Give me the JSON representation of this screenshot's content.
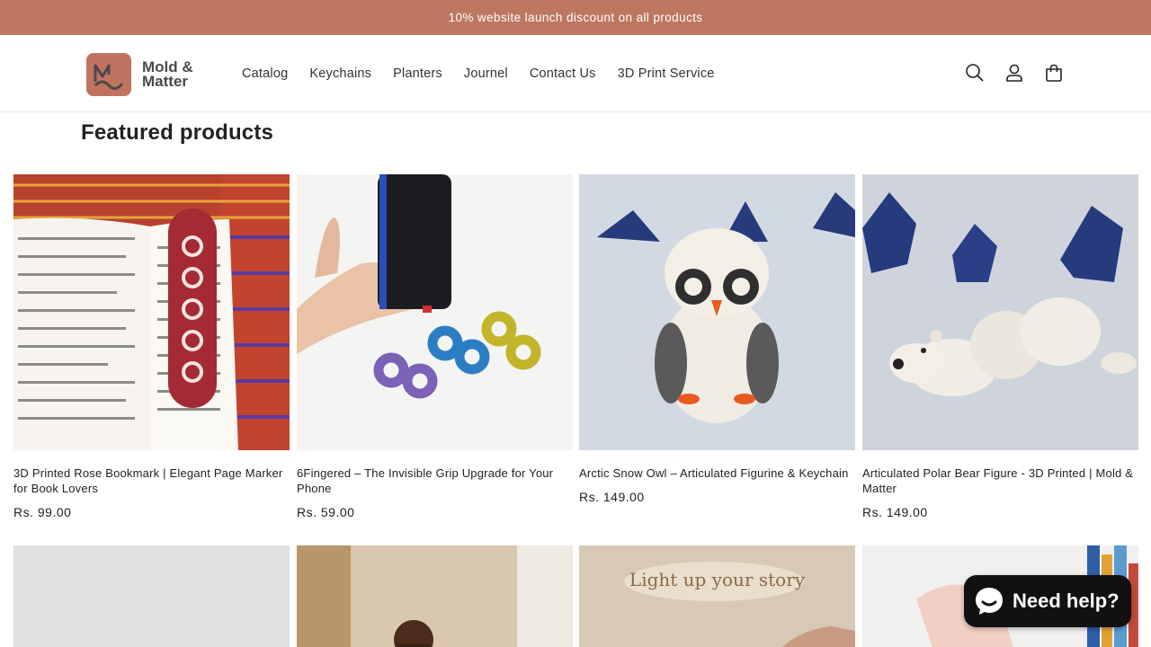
{
  "announcement": "10% website launch discount on all products",
  "brand": {
    "line1": "Mold &",
    "line2": "Matter",
    "color": "#c0735f"
  },
  "nav": [
    "Catalog",
    "Keychains",
    "Planters",
    "Journel",
    "Contact Us",
    "3D Print Service"
  ],
  "icons": [
    "search-icon",
    "account-icon",
    "cart-icon"
  ],
  "section": {
    "title": "Featured products"
  },
  "products": [
    {
      "title": "3D Printed Rose Bookmark | Elegant Page Marker for Book Lovers",
      "price": "Rs. 99.00"
    },
    {
      "title": "6Fingered – The Invisible Grip Upgrade for Your Phone",
      "price": "Rs. 59.00"
    },
    {
      "title": "Arctic Snow Owl – Articulated Figurine & Keychain",
      "price": "Rs. 149.00"
    },
    {
      "title": "Articulated Polar Bear Figure - 3D Printed | Mold & Matter",
      "price": "Rs. 149.00"
    }
  ],
  "row2_overlay": "Light up your story",
  "chat": {
    "label": "Need help?"
  },
  "colors": {
    "announcement_bg": "#bd7660",
    "chat_bg": "#111111"
  }
}
